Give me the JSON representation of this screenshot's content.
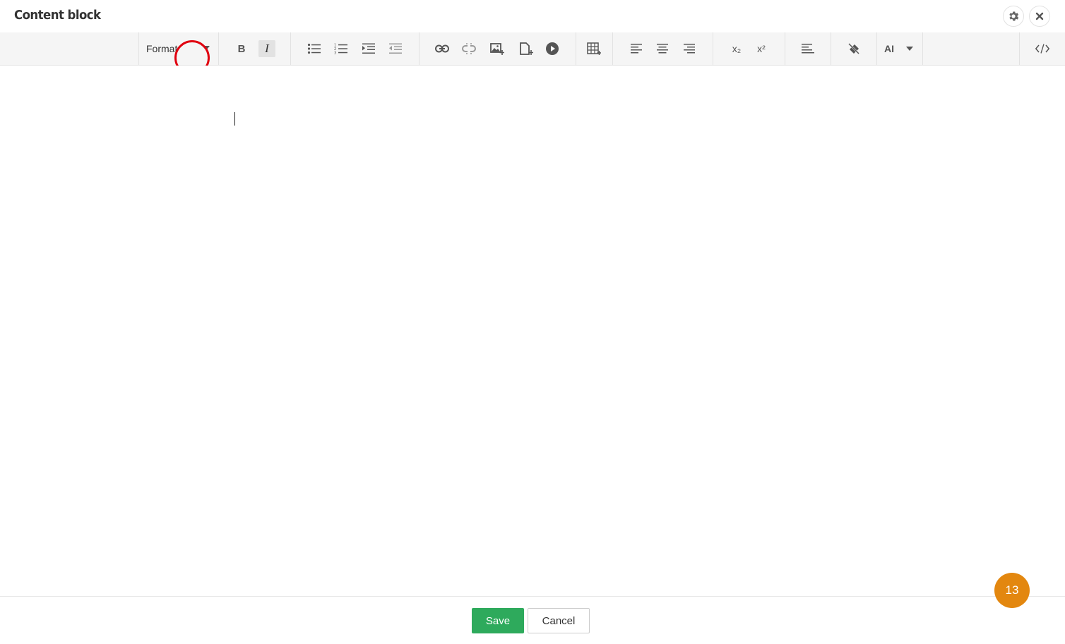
{
  "header": {
    "title": "Content block",
    "settings_icon": "gear-icon",
    "close_icon": "close-icon"
  },
  "toolbar": {
    "format_label": "Format",
    "buttons": [
      "bold",
      "italic",
      "bulleted-list",
      "numbered-list",
      "indent",
      "outdent",
      "link",
      "unlink",
      "insert-image",
      "insert-file",
      "insert-video",
      "insert-table",
      "align-left",
      "align-center",
      "align-right",
      "subscript",
      "superscript",
      "paragraph-format",
      "remove-format",
      "source-code"
    ],
    "bold_label": "B",
    "italic_label": "I",
    "italic_active": true,
    "subscript_label": "x₂",
    "superscript_label": "x²",
    "ai_label": "AI"
  },
  "editor": {
    "content": ""
  },
  "footer": {
    "save_label": "Save",
    "cancel_label": "Cancel"
  },
  "badge": {
    "count": "13"
  },
  "colors": {
    "save": "#2eaa5c",
    "badge": "#e3870f",
    "highlight_ring": "#e0000f",
    "toolbar_bg": "#f5f5f5"
  }
}
